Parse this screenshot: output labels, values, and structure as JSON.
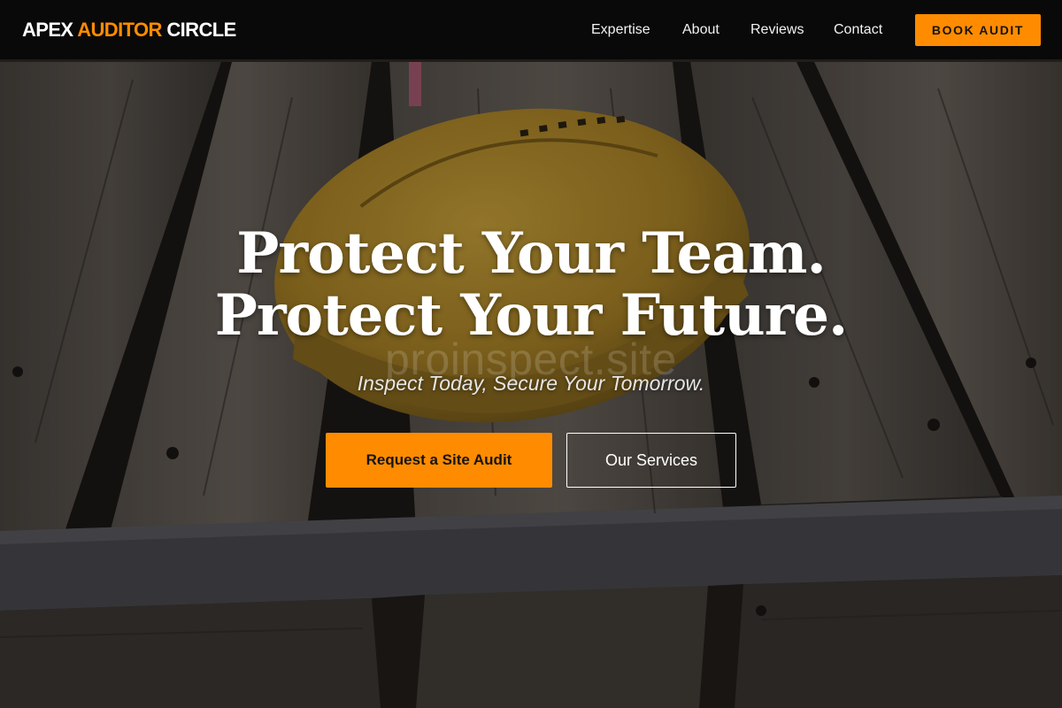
{
  "brand": {
    "name_part1": "APEX",
    "name_part2": "AUDITOR",
    "name_part3": "CIRCLE",
    "accent_color": "#ff8c00"
  },
  "nav": {
    "links": [
      "Expertise",
      "About",
      "Reviews",
      "Contact"
    ],
    "cta_label": "BOOK AUDIT"
  },
  "hero": {
    "headline_line1": "Protect Your Team.",
    "headline_line2": "Protect Your Future.",
    "watermark": "proinspect.site",
    "tagline": "Inspect Today, Secure Your Tomorrow.",
    "primary_cta": "Request a Site Audit",
    "secondary_cta": "Our Services",
    "background_image": "hard-hat-on-wooden-pallets"
  }
}
